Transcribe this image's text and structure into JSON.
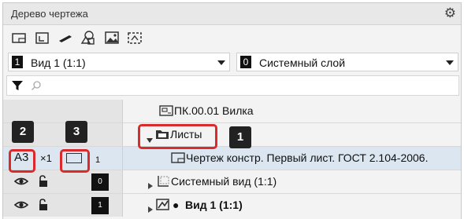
{
  "panel": {
    "title": "Дерево чертежа",
    "settings_icon": "gear-icon"
  },
  "toolbar": {
    "icons": [
      "drawing-view-icon",
      "layer-icon",
      "brush-icon",
      "shapes-icon",
      "image-icon",
      "insert-fragment-icon"
    ]
  },
  "view_select": {
    "number": "1",
    "label": "Вид 1 (1:1)"
  },
  "layer_select": {
    "number": "0",
    "label": "Системный слой"
  },
  "filter": {
    "icon": "funnel-icon",
    "search_icon": "search-icon"
  },
  "tree": {
    "document": {
      "label": "ПК.00.01 Вилка"
    },
    "sheets": {
      "label": "Листы"
    },
    "sheet": {
      "format": "А3",
      "multiplier": "×1",
      "number": "1",
      "label": "Чертеж констр. Первый лист. ГОСТ 2.104-2006."
    },
    "system_view": {
      "number": "0",
      "label": "Системный вид (1:1)"
    },
    "view1": {
      "number": "1",
      "bullet": "●",
      "label": "Вид 1 (1:1)"
    }
  },
  "markers": {
    "m1": "1",
    "m2": "2",
    "m3": "3"
  },
  "colors": {
    "highlight": "#d92b2b",
    "marker_bg": "#222222"
  }
}
